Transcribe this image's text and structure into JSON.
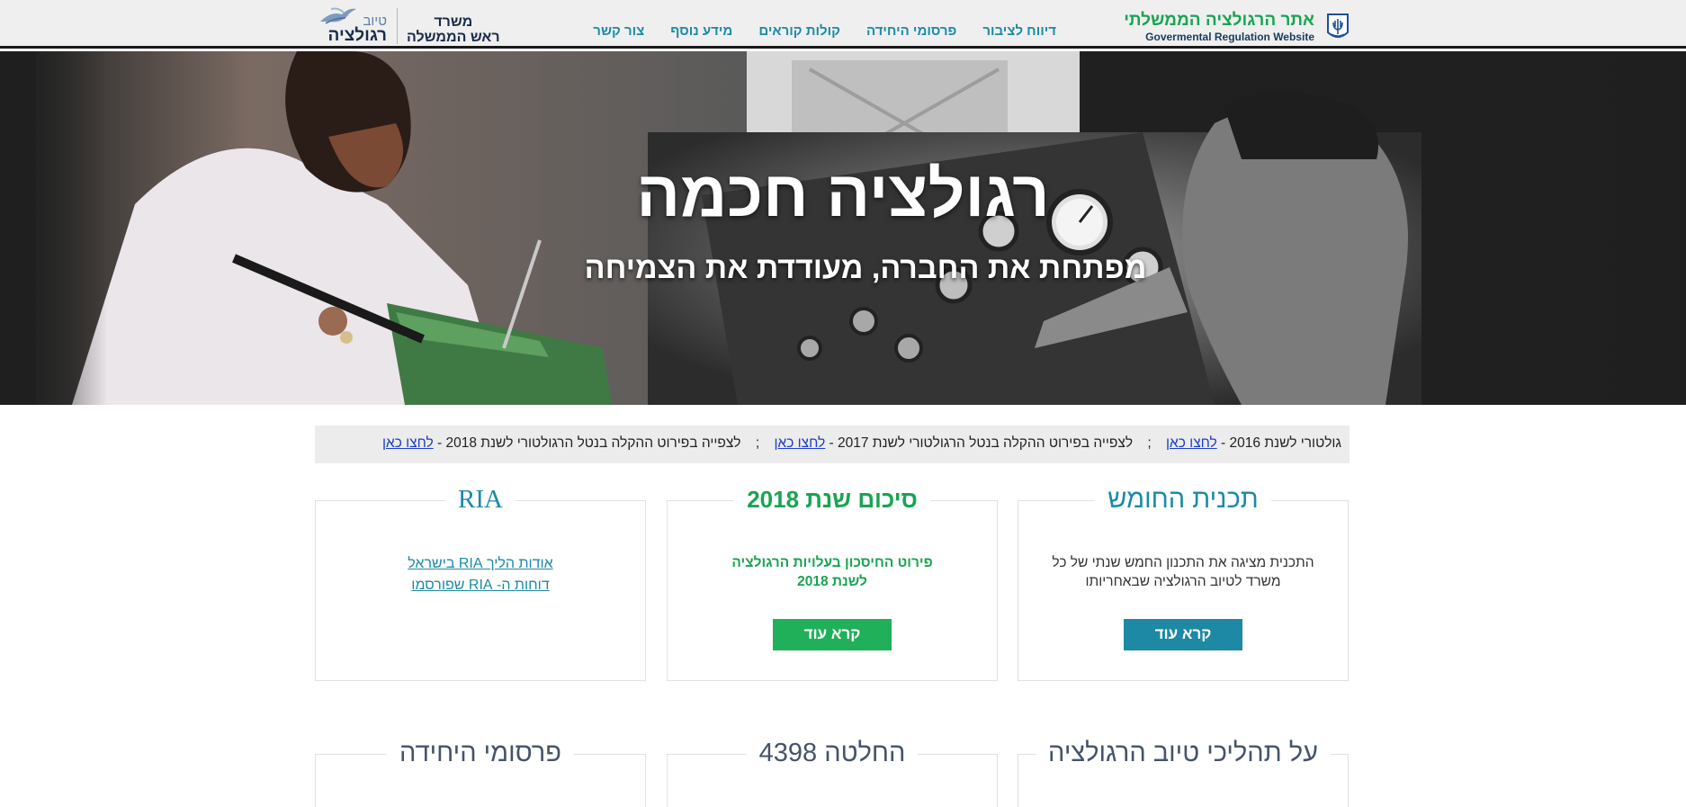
{
  "header": {
    "site_title_he": "אתר הרגולציה הממשלתי",
    "site_title_en": "Govermental Regulation Website",
    "nav": [
      "דיווח לציבור",
      "פרסומי היחידה",
      "קולות קוראים",
      "מידע נוסף",
      "צור קשר"
    ],
    "pm_office_line1": "משרד",
    "pm_office_line2": "ראש הממשלה",
    "tivuy_small": "טיוב",
    "tivuy_big": "רגולציה"
  },
  "hero": {
    "title": "רגולציה חכמה",
    "subtitle": "מפתחת את החברה, מעודדת את הצמיחה"
  },
  "ticker": {
    "items": [
      {
        "text": "גולטורי לשנת 2016 - ",
        "link": "לחצו כאן"
      },
      {
        "text": "לצפייה בפירוט ההקלה בנטל הרגולטורי לשנת 2017 - ",
        "link": "לחצו כאן"
      },
      {
        "text": "לצפייה בפירוט ההקלה בנטל הרגולטורי לשנת 2018 - ",
        "link": "לחצו כאן"
      }
    ],
    "separator": ";"
  },
  "cards": {
    "five_year": {
      "title": "תכנית החומש",
      "body": "התכנית מציגה את התכנון החמש שנתי של כל משרד לטיוב הרגולציה שבאחריותו",
      "button": "קרא עוד"
    },
    "summary_2018": {
      "title": "סיכום שנת 2018",
      "body_line1": "פירוט החיסכון בעלויות הרגולציה",
      "body_line2": "לשנת 2018",
      "button": "קרא עוד"
    },
    "ria": {
      "title": "RIA",
      "link1": "אודות הליך RIA בישראל",
      "link2": "דוחות ה- RIA שפורסמו"
    },
    "processes": {
      "title": "על תהליכי טיוב הרגולציה"
    },
    "decision": {
      "title": "החלטה 4398"
    },
    "publications": {
      "title": "פרסומי היחידה"
    }
  },
  "colors": {
    "teal": "#1b8aa8",
    "green": "#21b05a",
    "header_bg": "#efefef",
    "ticker_bg": "#ececec",
    "link_blue": "#1a3ec8"
  }
}
